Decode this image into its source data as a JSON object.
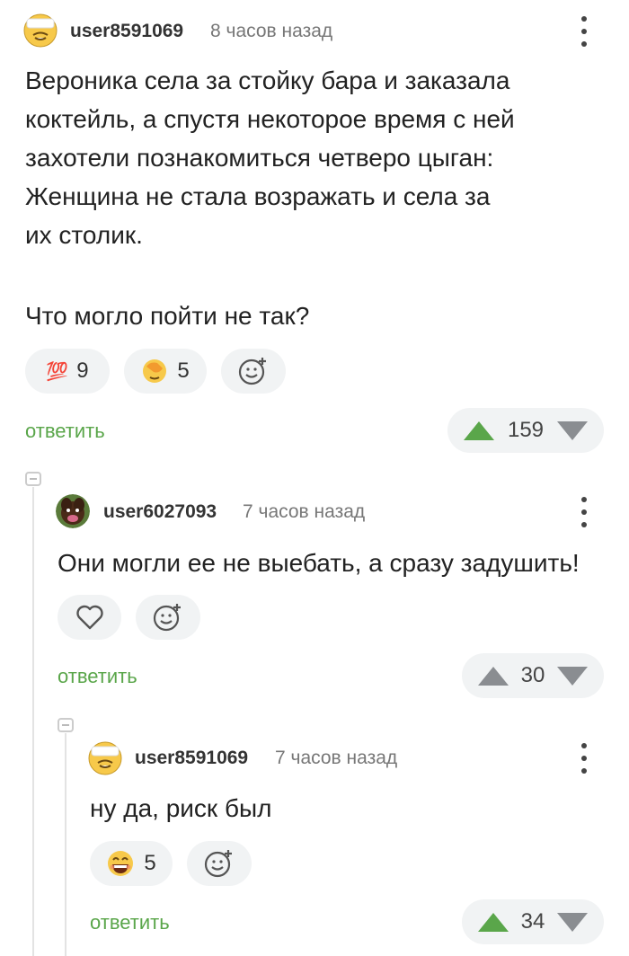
{
  "comment1": {
    "username": "user8591069",
    "time": "8 часов назад",
    "lines": [
      "Вероника села за стойку бара и заказала",
      "коктейль, а спустя некоторое время с ней",
      "захотели познакомиться четверо цыган:",
      "Женщина не стала возражать и села за",
      "их столик.",
      "Что могло пойти не так?"
    ],
    "reactions": [
      {
        "icon": "hundred-points-icon",
        "glyph": "💯",
        "count": "9"
      },
      {
        "icon": "facepalm-icon",
        "count": "5"
      }
    ],
    "reply_label": "ответить",
    "rating": "159"
  },
  "comment2": {
    "username": "user6027093",
    "time": "7 часов назад",
    "text": "Они могли ее не выебать, а сразу задушить!",
    "reply_label": "ответить",
    "rating": "30"
  },
  "comment3": {
    "username": "user8591069",
    "time": "7 часов назад",
    "text": "ну да, риск был",
    "reactions": [
      {
        "icon": "grinning-face-icon",
        "count": "5"
      }
    ],
    "reply_label": "ответить",
    "rating": "34"
  },
  "colors": {
    "accent_green": "#5aa64a",
    "pill_bg": "#f1f3f4",
    "arrow_gray": "#8a8d91"
  }
}
